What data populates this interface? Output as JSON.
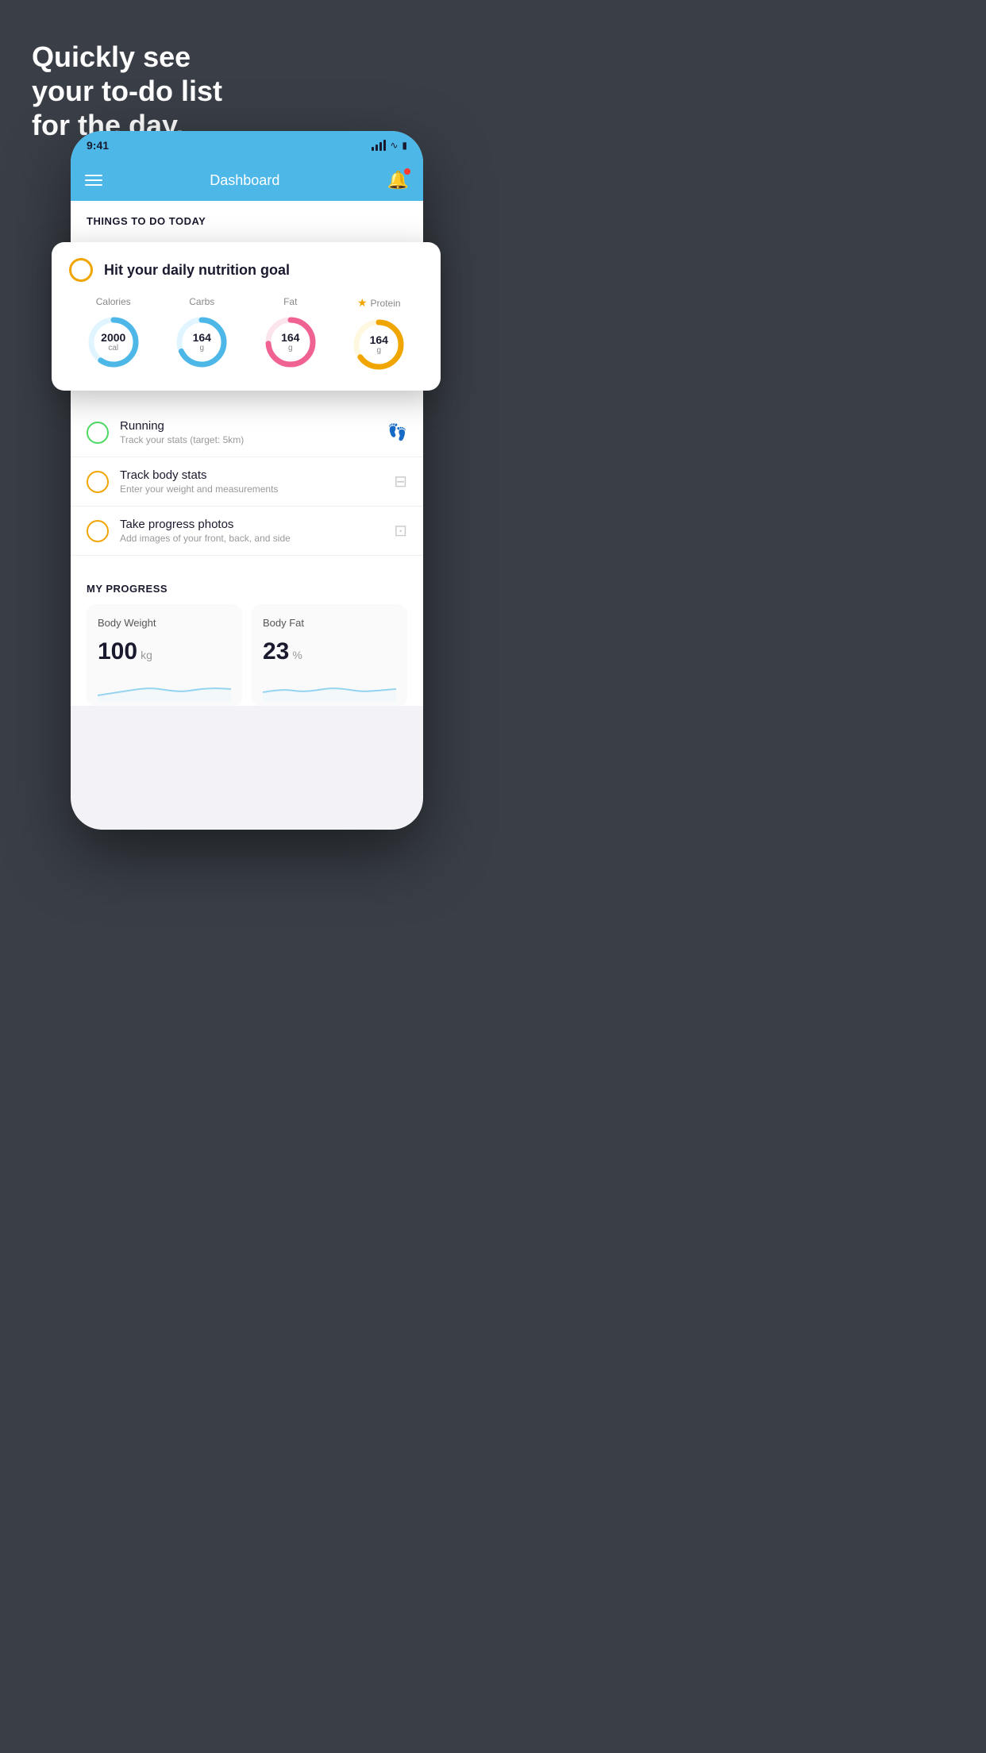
{
  "background": {
    "headline_line1": "Quickly see",
    "headline_line2": "your to-do list",
    "headline_line3": "for the day."
  },
  "phone": {
    "status_bar": {
      "time": "9:41",
      "signal_label": "signal",
      "wifi_label": "wifi",
      "battery_label": "battery"
    },
    "nav": {
      "title": "Dashboard",
      "menu_label": "menu",
      "bell_label": "notifications"
    },
    "section_title": "THINGS TO DO TODAY",
    "floating_card": {
      "title": "Hit your daily nutrition goal",
      "nutrition": [
        {
          "label": "Calories",
          "value": "2000",
          "unit": "cal",
          "color": "#4db8e8",
          "track_color": "#e0f5ff",
          "star": false
        },
        {
          "label": "Carbs",
          "value": "164",
          "unit": "g",
          "color": "#4db8e8",
          "track_color": "#e0f5ff",
          "star": false
        },
        {
          "label": "Fat",
          "value": "164",
          "unit": "g",
          "color": "#f06292",
          "track_color": "#fce4ec",
          "star": false
        },
        {
          "label": "Protein",
          "value": "164",
          "unit": "g",
          "color": "#f0a500",
          "track_color": "#fff8e1",
          "star": true
        }
      ]
    },
    "todo_items": [
      {
        "title": "Running",
        "subtitle": "Track your stats (target: 5km)",
        "circle_color": "green",
        "icon": "👟"
      },
      {
        "title": "Track body stats",
        "subtitle": "Enter your weight and measurements",
        "circle_color": "yellow",
        "icon": "⚖️"
      },
      {
        "title": "Take progress photos",
        "subtitle": "Add images of your front, back, and side",
        "circle_color": "yellow",
        "icon": "👤"
      }
    ],
    "progress": {
      "section_title": "MY PROGRESS",
      "cards": [
        {
          "title": "Body Weight",
          "value": "100",
          "unit": "kg"
        },
        {
          "title": "Body Fat",
          "value": "23",
          "unit": "%"
        }
      ]
    }
  }
}
